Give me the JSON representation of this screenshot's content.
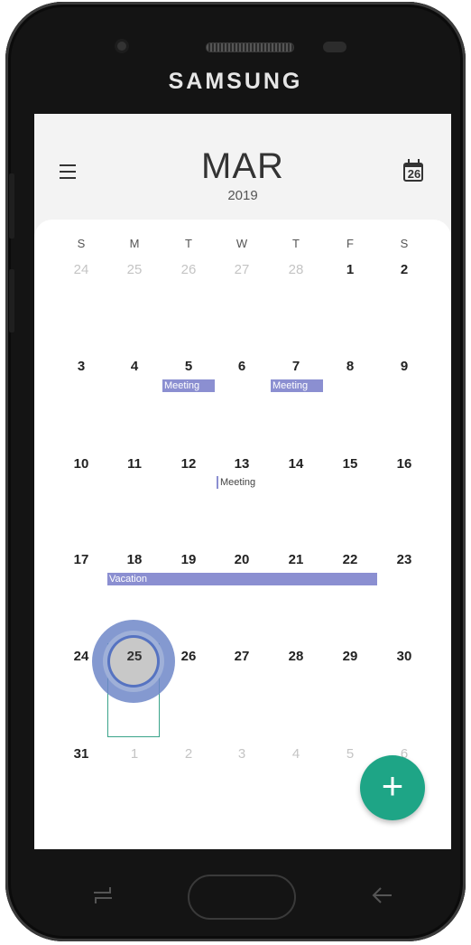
{
  "device": {
    "brand": "SAMSUNG"
  },
  "header": {
    "month": "MAR",
    "year": "2019",
    "today_icon_number": "26"
  },
  "weekdays": [
    "S",
    "M",
    "T",
    "W",
    "T",
    "F",
    "S"
  ],
  "weeks": [
    [
      "24",
      "25",
      "26",
      "27",
      "28",
      "1",
      "2"
    ],
    [
      "3",
      "4",
      "5",
      "6",
      "7",
      "8",
      "9"
    ],
    [
      "10",
      "11",
      "12",
      "13",
      "14",
      "15",
      "16"
    ],
    [
      "17",
      "18",
      "19",
      "20",
      "21",
      "22",
      "23"
    ],
    [
      "24",
      "25",
      "26",
      "27",
      "28",
      "29",
      "30"
    ],
    [
      "31",
      "1",
      "2",
      "3",
      "4",
      "5",
      "6"
    ]
  ],
  "events": {
    "meeting_5": "Meeting",
    "meeting_7": "Meeting",
    "meeting_13": "Meeting",
    "vacation": "Vacation"
  },
  "fab_label": "+",
  "colors": {
    "accent_green": "#1ea586",
    "event_purple": "#8b8fd1",
    "selection_border": "#3aa38a",
    "tap_indicator": "#5673c1"
  },
  "icons": {
    "menu": "hamburger-menu-icon",
    "today": "calendar-today-icon",
    "add": "plus-icon",
    "recent": "recent-apps-icon",
    "back": "back-arrow-icon"
  }
}
